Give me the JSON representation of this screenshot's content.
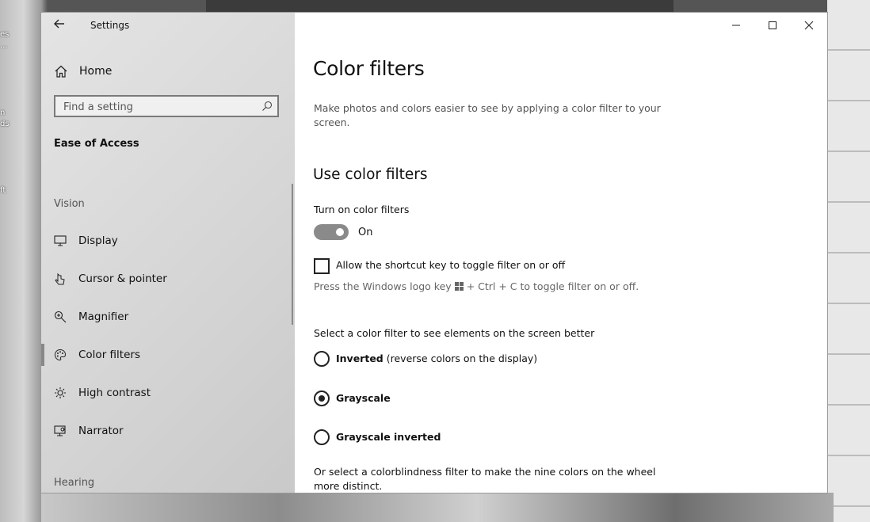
{
  "desktop": {
    "icon_labels": [
      "es",
      "...",
      "n",
      "ds",
      "ft"
    ]
  },
  "window": {
    "title": "Settings",
    "controls": {
      "minimize": "minimize",
      "maximize": "maximize",
      "close": "close"
    }
  },
  "sidebar": {
    "home_label": "Home",
    "search_placeholder": "Find a setting",
    "section_title": "Ease of Access",
    "group_vision": "Vision",
    "items": [
      {
        "label": "Display",
        "icon": "display-icon"
      },
      {
        "label": "Cursor & pointer",
        "icon": "cursor-icon"
      },
      {
        "label": "Magnifier",
        "icon": "magnifier-icon"
      },
      {
        "label": "Color filters",
        "icon": "palette-icon",
        "selected": true
      },
      {
        "label": "High contrast",
        "icon": "sun-icon"
      },
      {
        "label": "Narrator",
        "icon": "narrator-icon"
      }
    ],
    "group_hearing": "Hearing"
  },
  "main": {
    "title": "Color filters",
    "description": "Make photos and colors easier to see by applying a color filter to your screen.",
    "use_filters_title": "Use color filters",
    "toggle_label": "Turn on color filters",
    "toggle_state": "On",
    "toggle_on": true,
    "shortcut_label": "Allow the shortcut key to toggle filter on or off",
    "shortcut_checked": false,
    "hint_before": "Press the Windows logo key",
    "hint_after": "+ Ctrl + C to toggle filter on or off.",
    "select_prompt": "Select a color filter to see elements on the screen better",
    "filters": [
      {
        "name": "Inverted",
        "detail": "(reverse colors on the display)",
        "checked": false
      },
      {
        "name": "Grayscale",
        "detail": "",
        "checked": true
      },
      {
        "name": "Grayscale inverted",
        "detail": "",
        "checked": false
      }
    ],
    "colorblind_prompt": "Or select a colorblindness filter to make the nine colors on the wheel more distinct."
  }
}
